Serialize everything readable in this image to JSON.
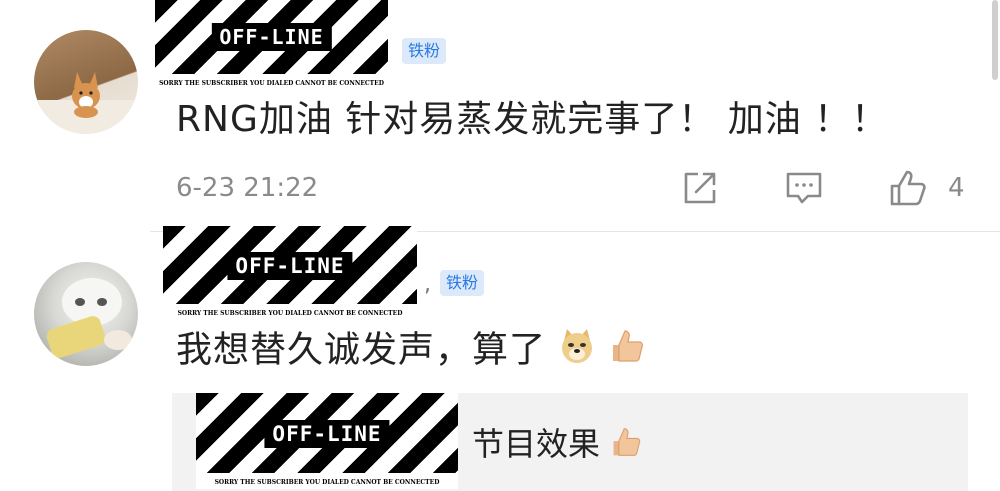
{
  "badge": {
    "logo_text": "OFF-LINE",
    "caption": "SORRY THE SUBSCRIBER YOU DIALED CANNOT BE CONNECTED"
  },
  "fan_tag": "铁粉",
  "separator": ",",
  "comments": [
    {
      "text": "RNG加油 针对易蒸发就完事了！ 加油 ！！",
      "time": "6-23 21:22",
      "likes": "4"
    },
    {
      "text": "我想替久诚发声，算了"
    }
  ],
  "reply": {
    "text": "节目效果"
  },
  "icons": {
    "share": "share-icon",
    "comment": "comment-icon",
    "like": "thumbs-up-icon",
    "doge": "doge-emoji",
    "thumb_emoji": "thumbs-up-emoji"
  },
  "colors": {
    "fan_tag_bg": "#dbe9fb",
    "fan_tag_text": "#2a7ae2",
    "meta_gray": "#8a8a8a",
    "reply_bg": "#f2f2f2"
  }
}
